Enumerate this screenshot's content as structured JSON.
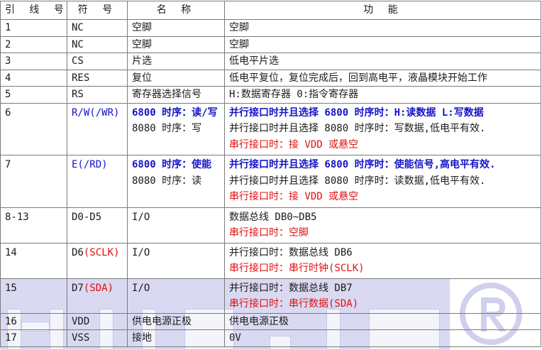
{
  "headers": {
    "pin": "引 线 号",
    "symbol": "符 号",
    "name": "名 称",
    "function": "功 能"
  },
  "rows": [
    {
      "pin": "1",
      "symbol": "NC",
      "name": "空脚",
      "func": [
        "空脚"
      ]
    },
    {
      "pin": "2",
      "symbol": "NC",
      "name": "空脚",
      "func": [
        "空脚"
      ]
    },
    {
      "pin": "3",
      "symbol": "CS",
      "name": "片选",
      "func": [
        "低电平片选"
      ]
    },
    {
      "pin": "4",
      "symbol": "RES",
      "name": "复位",
      "func": [
        "低电平复位，复位完成后，回到高电平，液晶模块开始工作"
      ]
    },
    {
      "pin": "5",
      "symbol": "RS",
      "name": "寄存器选择信号",
      "func": [
        "H:数据寄存器 0:指令寄存器"
      ]
    },
    {
      "pin": "6",
      "symbol": "R/W(/WR)",
      "name": [
        "6800 时序：读/写",
        "8080 时序：写"
      ],
      "func": [
        "并行接口时并且选择 6800 时序时：H:读数据  L:写数据",
        "并行接口时并且选择 8080 时序时：写数据,低电平有效.",
        "串行接口时：接 VDD 或悬空"
      ]
    },
    {
      "pin": "7",
      "symbol": "E(/RD)",
      "name": [
        "6800  时序：使能",
        "8080 时序：读"
      ],
      "func": [
        "并行接口时并且选择 6800 时序时：使能信号,高电平有效.",
        "并行接口时并且选择 8080 时序时：读数据,低电平有效.",
        "串行接口时：接 VDD 或悬空"
      ]
    },
    {
      "pin": "8-13",
      "symbol": "D0-D5",
      "name": "I/O",
      "func": [
        "数据总线 DB0~DB5",
        "串行接口时：空脚"
      ]
    },
    {
      "pin": "14",
      "symbol_main": "D6",
      "symbol_note": "(SCLK)",
      "name": "I/O",
      "func": [
        "并行接口时：数据总线 DB6",
        "串行接口时：串行时钟(SCLK)"
      ]
    },
    {
      "pin": "15",
      "symbol_main": "D7",
      "symbol_note": "(SDA)",
      "name": "I/O",
      "func": [
        "并行接口时：数据总线 DB7",
        "串行接口时：串行数据(SDA)"
      ]
    },
    {
      "pin": "16",
      "symbol": "VDD",
      "name": "供电电源正极",
      "func": [
        "供电电源正极"
      ]
    },
    {
      "pin": "17",
      "symbol": "VSS",
      "name": "接地",
      "func": [
        "0V"
      ]
    }
  ],
  "colors": {
    "blue": "#1414c8",
    "red": "#e01010",
    "watermark": "#d9d9f2"
  }
}
